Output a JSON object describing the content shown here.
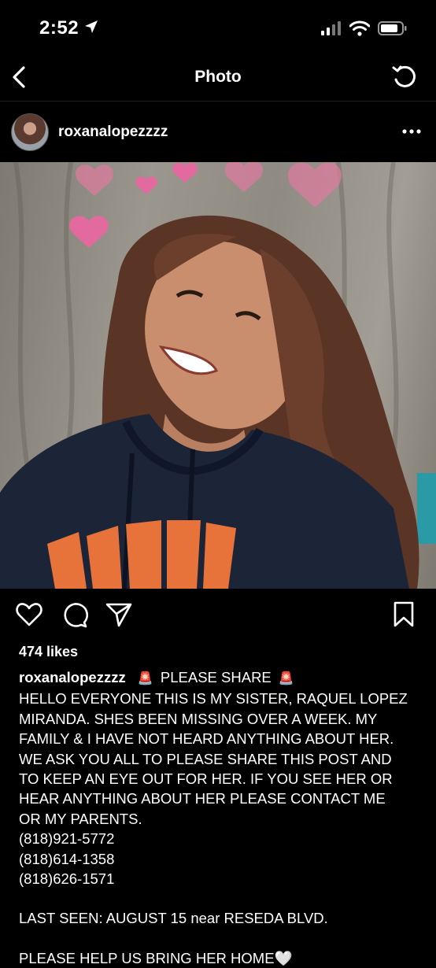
{
  "status_bar": {
    "time": "2:52",
    "icons": [
      "location-arrow-icon",
      "cellular-signal-icon",
      "wifi-icon",
      "battery-icon"
    ]
  },
  "nav": {
    "title": "Photo",
    "icons": [
      "back-chevron-icon",
      "refresh-icon"
    ]
  },
  "post": {
    "username": "roxanalopezzzz",
    "icons": [
      "more-options-icon"
    ],
    "actions": [
      "heart-icon",
      "comment-icon",
      "share-icon",
      "bookmark-icon"
    ],
    "likes": "474 likes",
    "caption": {
      "username": "roxanalopezzzz",
      "headline": "PLEASE SHARE",
      "siren_icon": "🚨",
      "lines": [
        "HELLO EVERYONE THIS IS MY SISTER, RAQUEL LOPEZ",
        "MIRANDA. SHES BEEN MISSING OVER A WEEK. MY",
        "FAMILY & I HAVE NOT HEARD ANYTHING ABOUT HER.",
        "WE ASK YOU ALL TO PLEASE SHARE THIS POST AND",
        "TO KEEP AN EYE OUT FOR HER. IF YOU SEE HER OR",
        "HEAR ANYTHING ABOUT HER PLEASE CONTACT ME",
        "OR MY PARENTS.",
        "(818)921-5772",
        "(818)614-1358",
        "(818)626-1571"
      ],
      "last_seen": "LAST SEEN: AUGUST 15 near RESEDA BLVD.",
      "cut_line": "PLEASE HELP US BRING HER HOME🤍"
    }
  }
}
